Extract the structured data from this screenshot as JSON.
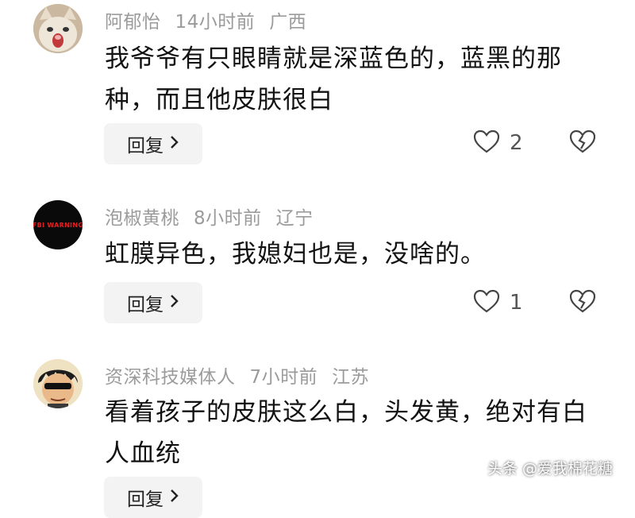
{
  "comments": [
    {
      "username": "阿郁怡",
      "time": "14小时前",
      "location": "广西",
      "text": "我爷爷有只眼睛就是深蓝色的，蓝黑的那种，而且他皮肤很白",
      "reply_label": "回复",
      "likes": "2"
    },
    {
      "username": "泡椒黄桃",
      "time": "8小时前",
      "location": "辽宁",
      "avatar_text": "FBI WARNING",
      "text": "虹膜异色，我媳妇也是，没啥的。",
      "reply_label": "回复",
      "likes": "1"
    },
    {
      "username": "资深科技媒体人",
      "time": "7小时前",
      "location": "江苏",
      "text": "看着孩子的皮肤这么白，头发黄，绝对有白人血统",
      "reply_label": "回复"
    }
  ],
  "watermark": "头条 @爱我棉花糖",
  "colors": {
    "meta": "#9b9b9b",
    "text": "#121212",
    "reply_bg": "#f3f3f3",
    "avatar2_bg": "#0a0a0a",
    "avatar2_text": "#e02020"
  },
  "icons": [
    "heart-outline-icon",
    "broken-heart-icon",
    "chevron-right-icon"
  ]
}
